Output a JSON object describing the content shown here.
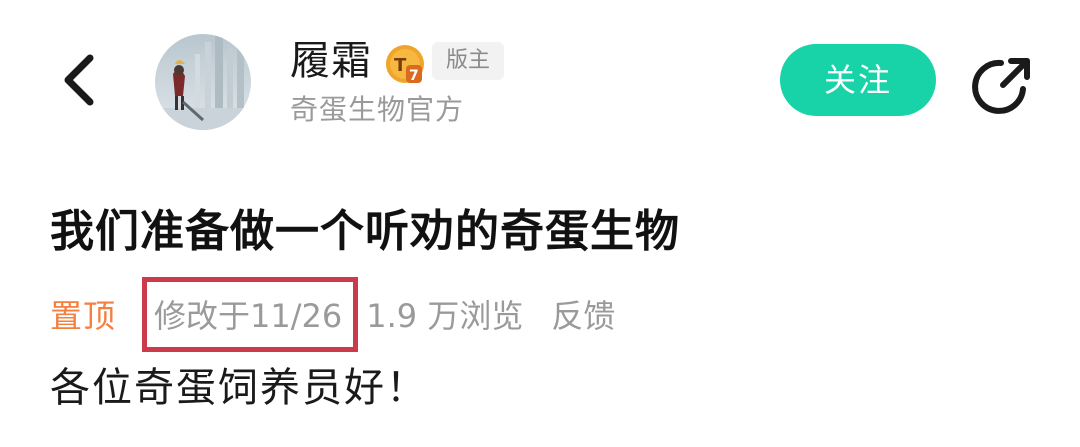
{
  "header": {
    "author_name": "履霜",
    "level_badge": "T7",
    "role_tag": "版主",
    "author_subtitle": "奇蛋生物官方",
    "follow_label": "关注",
    "icons": {
      "back": "back-arrow-icon",
      "share": "share-icon",
      "level": "level-badge-icon"
    }
  },
  "post": {
    "title": "我们准备做一个听劝的奇蛋生物",
    "meta": {
      "pinned_label": "置顶",
      "edited_label": "修改于11/26",
      "views_label": "1.9 万浏览",
      "feedback_label": "反馈"
    },
    "body_first_line": "各位奇蛋饲养员好！"
  },
  "colors": {
    "accent": "#19d3a8",
    "pinned": "#f47f3e",
    "highlight_box": "#cc3b4b",
    "muted_text": "#9a9a9a",
    "badge": "#f0a52a"
  }
}
